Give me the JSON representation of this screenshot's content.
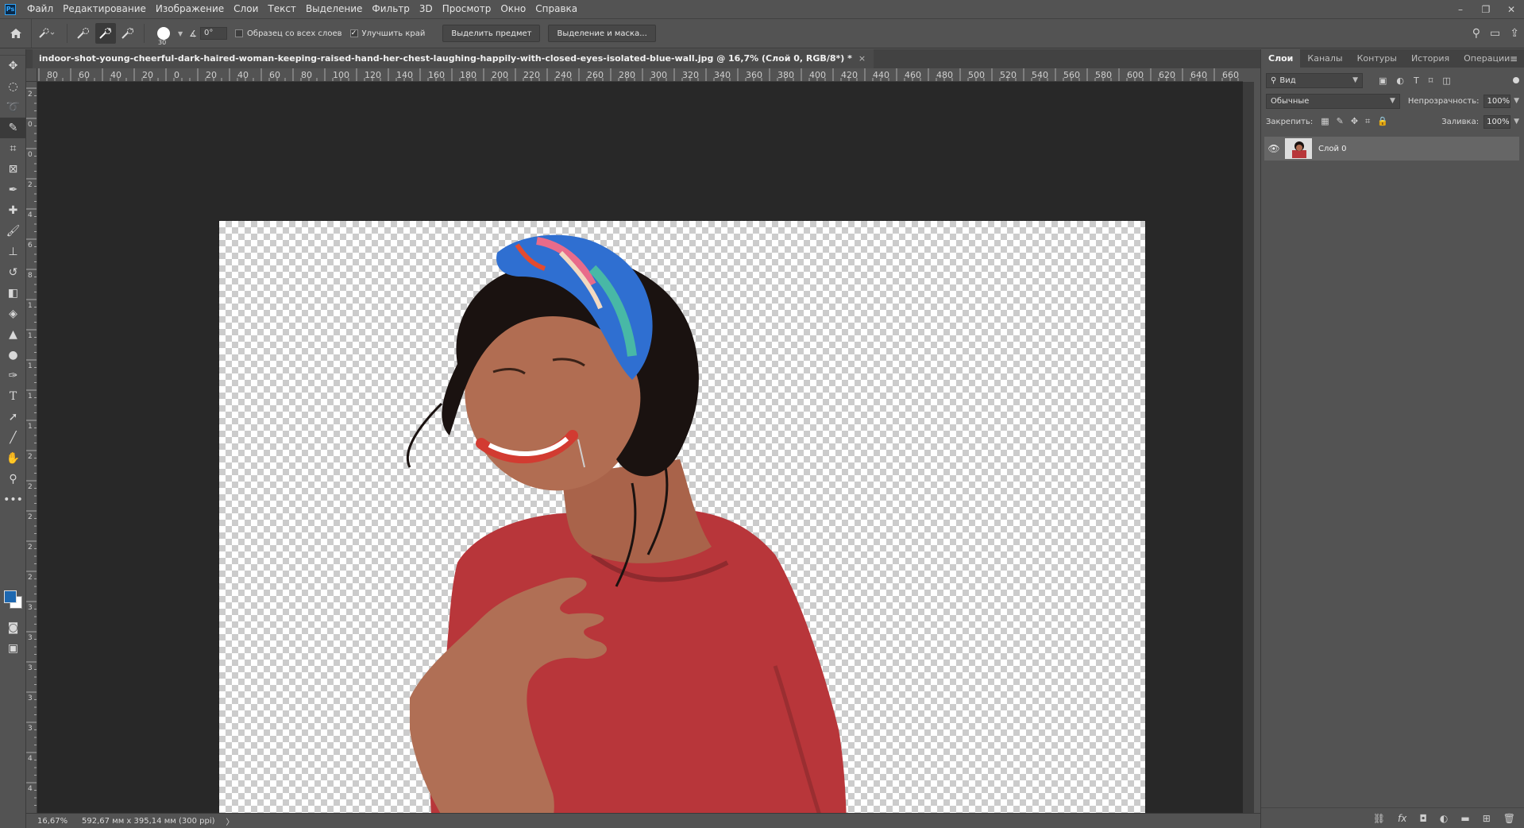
{
  "app": {
    "logo": "Ps"
  },
  "menu": [
    "Файл",
    "Редактирование",
    "Изображение",
    "Слои",
    "Текст",
    "Выделение",
    "Фильтр",
    "3D",
    "Просмотр",
    "Окно",
    "Справка"
  ],
  "window_controls": {
    "minimize": "–",
    "restore": "❐",
    "close": "✕"
  },
  "options": {
    "brush_size": "30",
    "angle": "0°",
    "sample_all_layers": "Образец со всех слоев",
    "sample_all_checked": false,
    "enhance_edge": "Улучшить край",
    "enhance_edge_checked": true,
    "select_subject": "Выделить предмет",
    "select_and_mask": "Выделение и маска..."
  },
  "document": {
    "tab_title": "indoor-shot-young-cheerful-dark-haired-woman-keeping-raised-hand-her-chest-laughing-happily-with-closed-eyes-isolated-blue-wall.jpg @ 16,7% (Слой 0, RGB/8*) *",
    "close": "×"
  },
  "ruler_h": [
    "80",
    "60",
    "40",
    "20",
    "0",
    "20",
    "40",
    "60",
    "80",
    "100",
    "120",
    "140",
    "160",
    "180",
    "200",
    "220",
    "240",
    "260",
    "280",
    "300",
    "320",
    "340",
    "360",
    "380",
    "400",
    "420",
    "440",
    "460",
    "480",
    "500",
    "520",
    "540",
    "560",
    "580",
    "600",
    "620",
    "640",
    "660"
  ],
  "ruler_v": [
    "2",
    "0",
    "0",
    "2",
    "4",
    "6",
    "8",
    "1",
    "1",
    "1",
    "1",
    "1",
    "2",
    "2",
    "2",
    "2",
    "2",
    "3",
    "3",
    "3",
    "3",
    "3",
    "4",
    "4"
  ],
  "status": {
    "zoom": "16,67%",
    "info": "592,67 мм x 395,14 мм (300 ppi)",
    "arrow": "〉"
  },
  "panel": {
    "tabs": [
      "Слои",
      "Каналы",
      "Контуры",
      "История",
      "Операции"
    ],
    "active_tab": "Слои",
    "filter_kind": "Вид",
    "blend_mode": "Обычные",
    "opacity_label": "Непрозрачность:",
    "opacity_value": "100%",
    "lock_label": "Закрепить:",
    "fill_label": "Заливка:",
    "fill_value": "100%",
    "layers": [
      {
        "name": "Слой 0",
        "visible": true
      }
    ]
  },
  "colors": {
    "foreground": "#1e68b0",
    "background": "#ffffff",
    "shirt": "#b8363a",
    "skin": "#a9634a",
    "hair": "#1a1210"
  }
}
